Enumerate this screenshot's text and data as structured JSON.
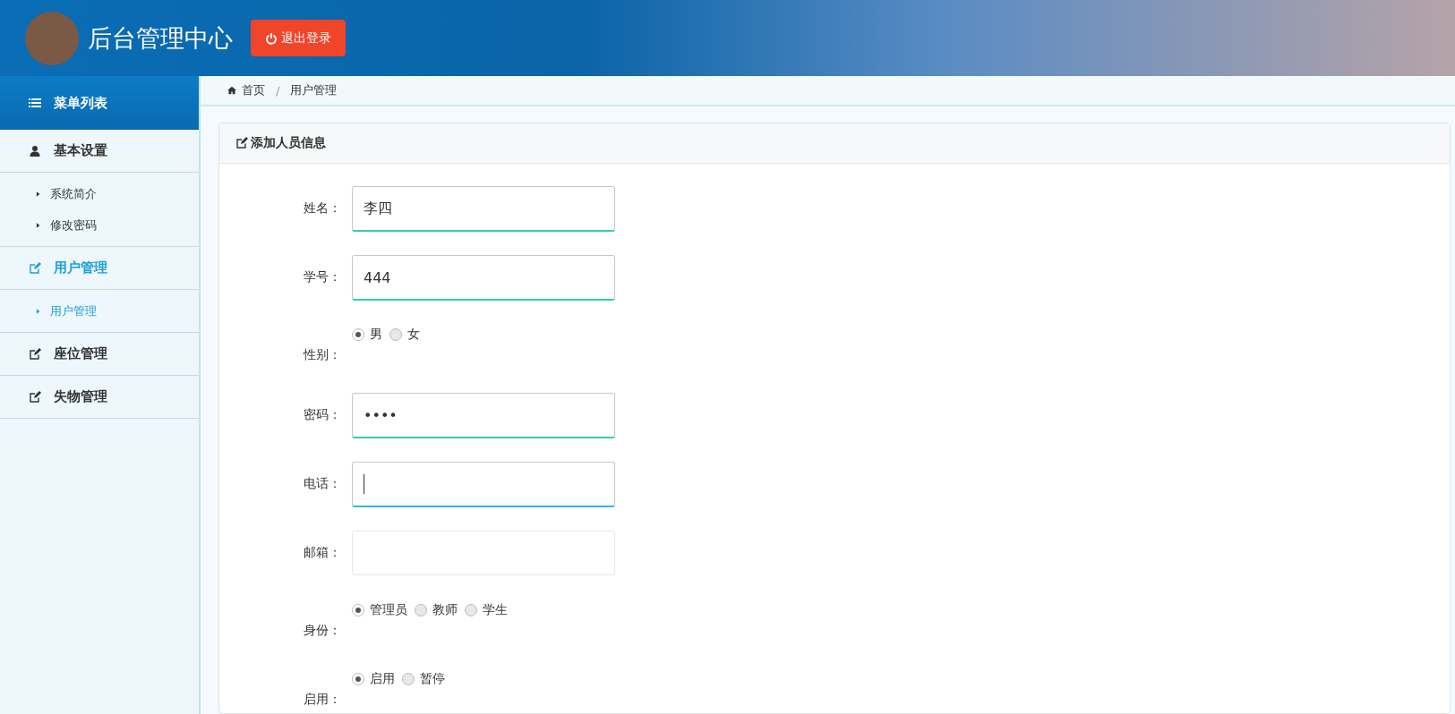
{
  "header": {
    "title": "后台管理中心",
    "logout": "退出登录"
  },
  "sidebar": {
    "title": "菜单列表",
    "groups": [
      {
        "label": "基本设置",
        "kind": "user",
        "selected": false,
        "children": [
          {
            "label": "系统简介",
            "selected": false
          },
          {
            "label": "修改密码",
            "selected": false
          }
        ]
      },
      {
        "label": "用户管理",
        "kind": "edit",
        "selected": true,
        "children": [
          {
            "label": "用户管理",
            "selected": true
          }
        ]
      },
      {
        "label": "座位管理",
        "kind": "edit",
        "selected": false
      },
      {
        "label": "失物管理",
        "kind": "edit",
        "selected": false
      }
    ]
  },
  "breadcrumb": {
    "separator": "/",
    "items": [
      {
        "label": "首页",
        "kind": "home"
      },
      {
        "label": "用户管理",
        "kind": "page"
      }
    ]
  },
  "panel": {
    "title": "添加人员信息",
    "rows": [
      {
        "kind": "input",
        "label": "姓名：",
        "value": "李四",
        "valid": true,
        "focused": false
      },
      {
        "kind": "input",
        "label": "学号：",
        "value": "444",
        "valid": true,
        "focused": false
      },
      {
        "kind": "radio",
        "label": "性别：",
        "options": [
          {
            "label": "男",
            "selected": true
          },
          {
            "label": "女",
            "selected": false
          }
        ]
      },
      {
        "kind": "input",
        "label": "密码：",
        "value": "••••",
        "valid": true,
        "focused": false
      },
      {
        "kind": "input",
        "label": "电话：",
        "valid": false,
        "focused": true
      },
      {
        "kind": "input",
        "label": "邮箱：",
        "valid": false,
        "focused": false
      },
      {
        "kind": "radio",
        "label": "身份：",
        "options": [
          {
            "label": "管理员",
            "selected": true
          },
          {
            "label": "教师",
            "selected": false
          },
          {
            "label": "学生",
            "selected": false
          }
        ]
      },
      {
        "kind": "radio",
        "label": "启用：",
        "options": [
          {
            "label": "启用",
            "selected": true
          },
          {
            "label": "暂停",
            "selected": false
          }
        ]
      }
    ]
  }
}
